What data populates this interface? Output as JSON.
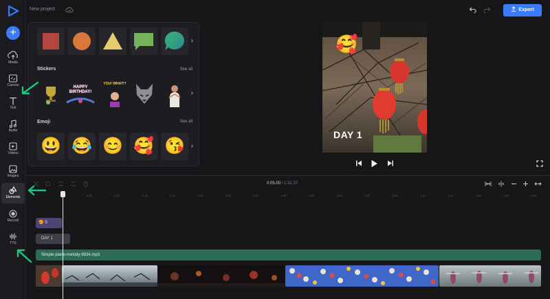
{
  "app": {
    "project_name": "New project"
  },
  "toolbar": {
    "export_label": "Export"
  },
  "nav": {
    "items": [
      {
        "label": "Media"
      },
      {
        "label": "Canvas"
      },
      {
        "label": "Text"
      },
      {
        "label": "Audio"
      },
      {
        "label": "Videos"
      },
      {
        "label": "Images"
      },
      {
        "label": "Elements"
      },
      {
        "label": "Record"
      },
      {
        "label": "TTS"
      }
    ],
    "active": "Elements"
  },
  "panel": {
    "stickers_title": "Stickers",
    "stickers_see_all": "See all",
    "emoji_title": "Emoji",
    "emoji_see_all": "See all",
    "shapes": [
      "square",
      "circle",
      "triangle",
      "speech-bubble",
      "chat-bubble"
    ],
    "sticker_labels": [
      "HAPPY BIRTHDAY!",
      "YOU! WHAT!?"
    ],
    "emoji": [
      "😃",
      "😂",
      "😊",
      "🥰",
      "😘"
    ]
  },
  "preview": {
    "overlay_text": "DAY 1",
    "overlay_emoji": "🥰"
  },
  "timeline": {
    "current_time": "0:05.00",
    "separator": "/",
    "duration": "1:31.37",
    "ruler_ticks": [
      "0:10",
      "0:15",
      "0:20",
      "0:25",
      "0:30",
      "0:35",
      "0:40",
      "0:45",
      "0:50",
      "0:55",
      "1:00",
      "1:05",
      "1:10",
      "1:15",
      "1:20",
      "1:25",
      "1:30"
    ],
    "clip_emoji_label": "S",
    "clip_text_label": "DAY 1",
    "clip_audio_label": "Simple-piano-melody-9834.mp3"
  },
  "colors": {
    "accent": "#3a7bff",
    "arrow": "#1fc77e",
    "audio": "#2d6b56"
  }
}
